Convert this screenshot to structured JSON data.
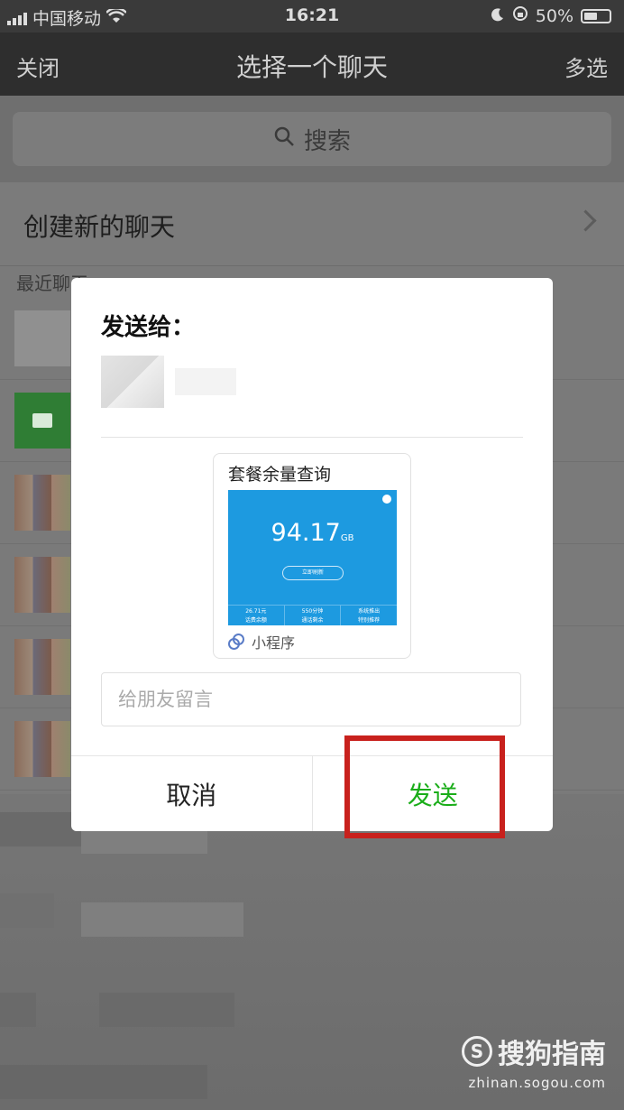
{
  "status_bar": {
    "carrier": "中国移动",
    "time": "16:21",
    "battery": "50%"
  },
  "nav": {
    "close": "关闭",
    "title": "选择一个聊天",
    "multi_select": "多选"
  },
  "search": {
    "placeholder": "搜索"
  },
  "create_chat": {
    "label": "创建新的聊天"
  },
  "recent": {
    "label": "最近聊天"
  },
  "dialog": {
    "heading": "发送给：",
    "card": {
      "title": "套餐余量查询",
      "amount": "94.17",
      "unit": "GB",
      "refresh": "立即刷新",
      "stats": [
        {
          "value": "26.71元",
          "label": "话费余额"
        },
        {
          "value": "550分钟",
          "label": "通话剩余"
        },
        {
          "value": "系统推出",
          "label": "特别推荐"
        }
      ],
      "mini_program": "小程序"
    },
    "message_placeholder": "给朋友留言",
    "cancel": "取消",
    "send": "发送"
  },
  "watermark": {
    "brand": "搜狗指南",
    "url": "zhinan.sogou.com"
  }
}
